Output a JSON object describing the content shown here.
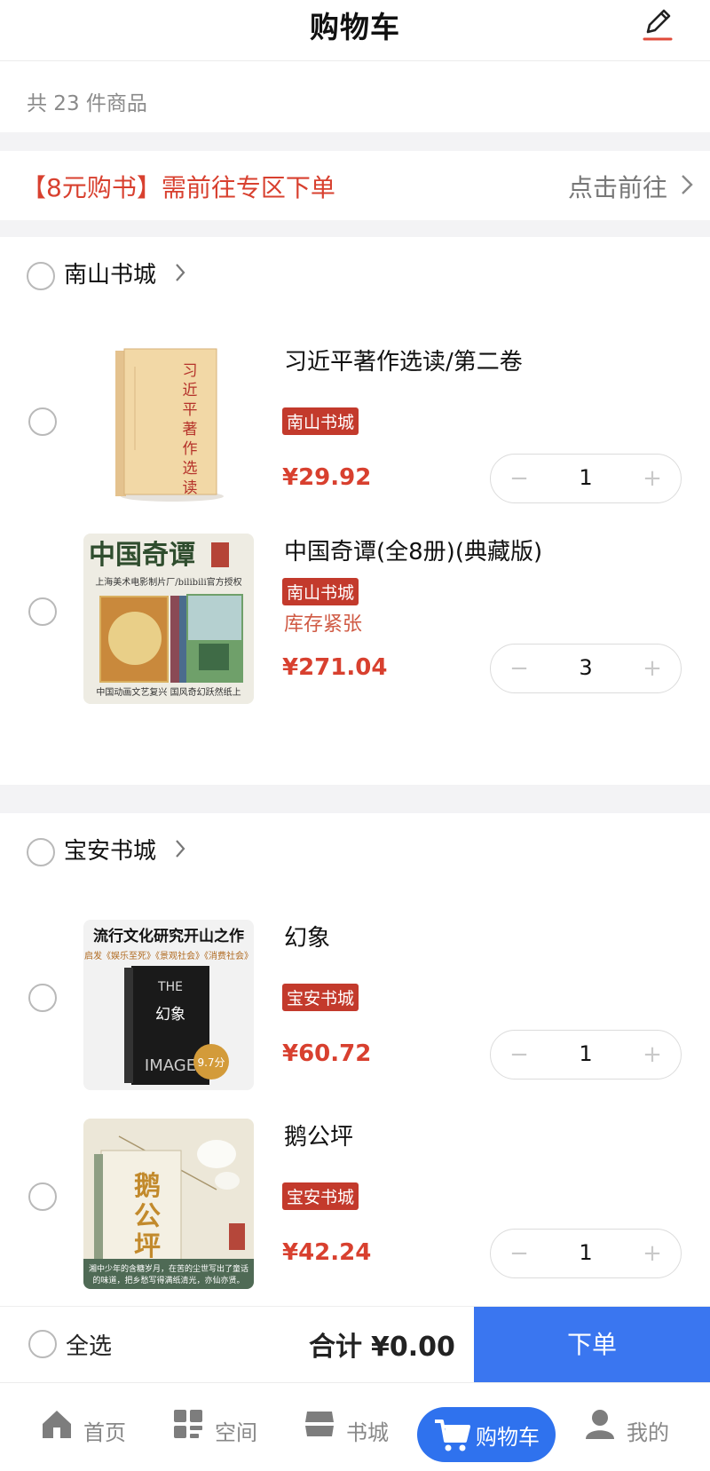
{
  "header": {
    "title": "购物车"
  },
  "summary": {
    "count_text": "共 23 件商品"
  },
  "promo": {
    "text": "【8元购书】需前往专区下单",
    "link": "点击前往"
  },
  "stores": [
    {
      "name": "南山书城",
      "items": [
        {
          "title": "习近平著作选读/第二卷",
          "tag": "南山书城",
          "stock": "",
          "price": "¥29.92",
          "qty": "1",
          "cover_text": "习近平著作选读"
        },
        {
          "title": "中国奇谭(全8册)(典藏版)",
          "tag": "南山书城",
          "stock": "库存紧张",
          "price": "¥271.04",
          "qty": "3",
          "cover_text": "中国奇谭"
        }
      ]
    },
    {
      "name": "宝安书城",
      "items": [
        {
          "title": "幻象",
          "tag": "宝安书城",
          "stock": "",
          "price": "¥60.72",
          "qty": "1",
          "cover_text": "流行文化研究开山之作"
        },
        {
          "title": "鹅公坪",
          "tag": "宝安书城",
          "stock": "",
          "price": "¥42.24",
          "qty": "1",
          "cover_text": "鹅公坪"
        }
      ]
    }
  ],
  "stepper": {
    "minus": "−",
    "plus": "+"
  },
  "checkout": {
    "select_all": "全选",
    "total_label": "合计",
    "total_value": "¥0.00",
    "order_button": "下单"
  },
  "tabbar": [
    {
      "label": "首页",
      "icon": "home-icon"
    },
    {
      "label": "空间",
      "icon": "space-icon"
    },
    {
      "label": "书城",
      "icon": "bookstore-icon"
    },
    {
      "label": "购物车",
      "icon": "cart-icon",
      "active": true
    },
    {
      "label": "我的",
      "icon": "user-icon"
    }
  ],
  "colors": {
    "accent_red": "#d8402f",
    "tag_red": "#c33a2c",
    "primary_blue": "#3a76f0"
  }
}
